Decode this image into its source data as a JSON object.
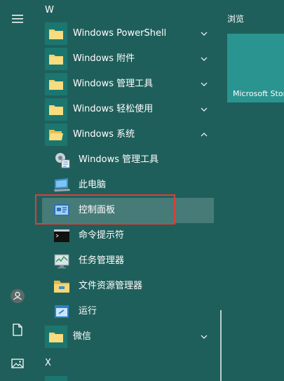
{
  "rail": {
    "icons": [
      "hamburger-icon",
      "user-avatar-icon",
      "document-icon",
      "pictures-icon"
    ]
  },
  "menu": {
    "sections": [
      {
        "letter": "W",
        "items": [
          {
            "label": "Windows PowerShell",
            "icon": "folder-icon",
            "expandable": true,
            "expanded": false
          },
          {
            "label": "Windows 附件",
            "icon": "folder-icon",
            "expandable": true,
            "expanded": false
          },
          {
            "label": "Windows 管理工具",
            "icon": "folder-icon",
            "expandable": true,
            "expanded": false
          },
          {
            "label": "Windows 轻松使用",
            "icon": "folder-icon",
            "expandable": true,
            "expanded": false
          },
          {
            "label": "Windows 系统",
            "icon": "folder-open-icon",
            "expandable": true,
            "expanded": true
          }
        ],
        "subitems": [
          {
            "label": "Windows 管理工具",
            "icon": "admin-tools-icon"
          },
          {
            "label": "此电脑",
            "icon": "this-pc-icon"
          },
          {
            "label": "控制面板",
            "icon": "control-panel-icon",
            "highlighted": true
          },
          {
            "label": "命令提示符",
            "icon": "cmd-icon"
          },
          {
            "label": "任务管理器",
            "icon": "task-manager-icon"
          },
          {
            "label": "文件资源管理器",
            "icon": "file-explorer-icon"
          },
          {
            "label": "运行",
            "icon": "run-icon"
          }
        ],
        "after": [
          {
            "label": "微信",
            "icon": "folder-icon",
            "expandable": true,
            "expanded": false
          }
        ]
      },
      {
        "letter": "X"
      }
    ]
  },
  "right": {
    "browse_label": "浏览",
    "store_tile_label": "Microsoft Store"
  },
  "colors": {
    "background": "#1f5f5b",
    "tile": "#1c7670",
    "store_tile": "#2a9490",
    "highlight_box": "#d9403a",
    "folder": "#f5d36b"
  }
}
